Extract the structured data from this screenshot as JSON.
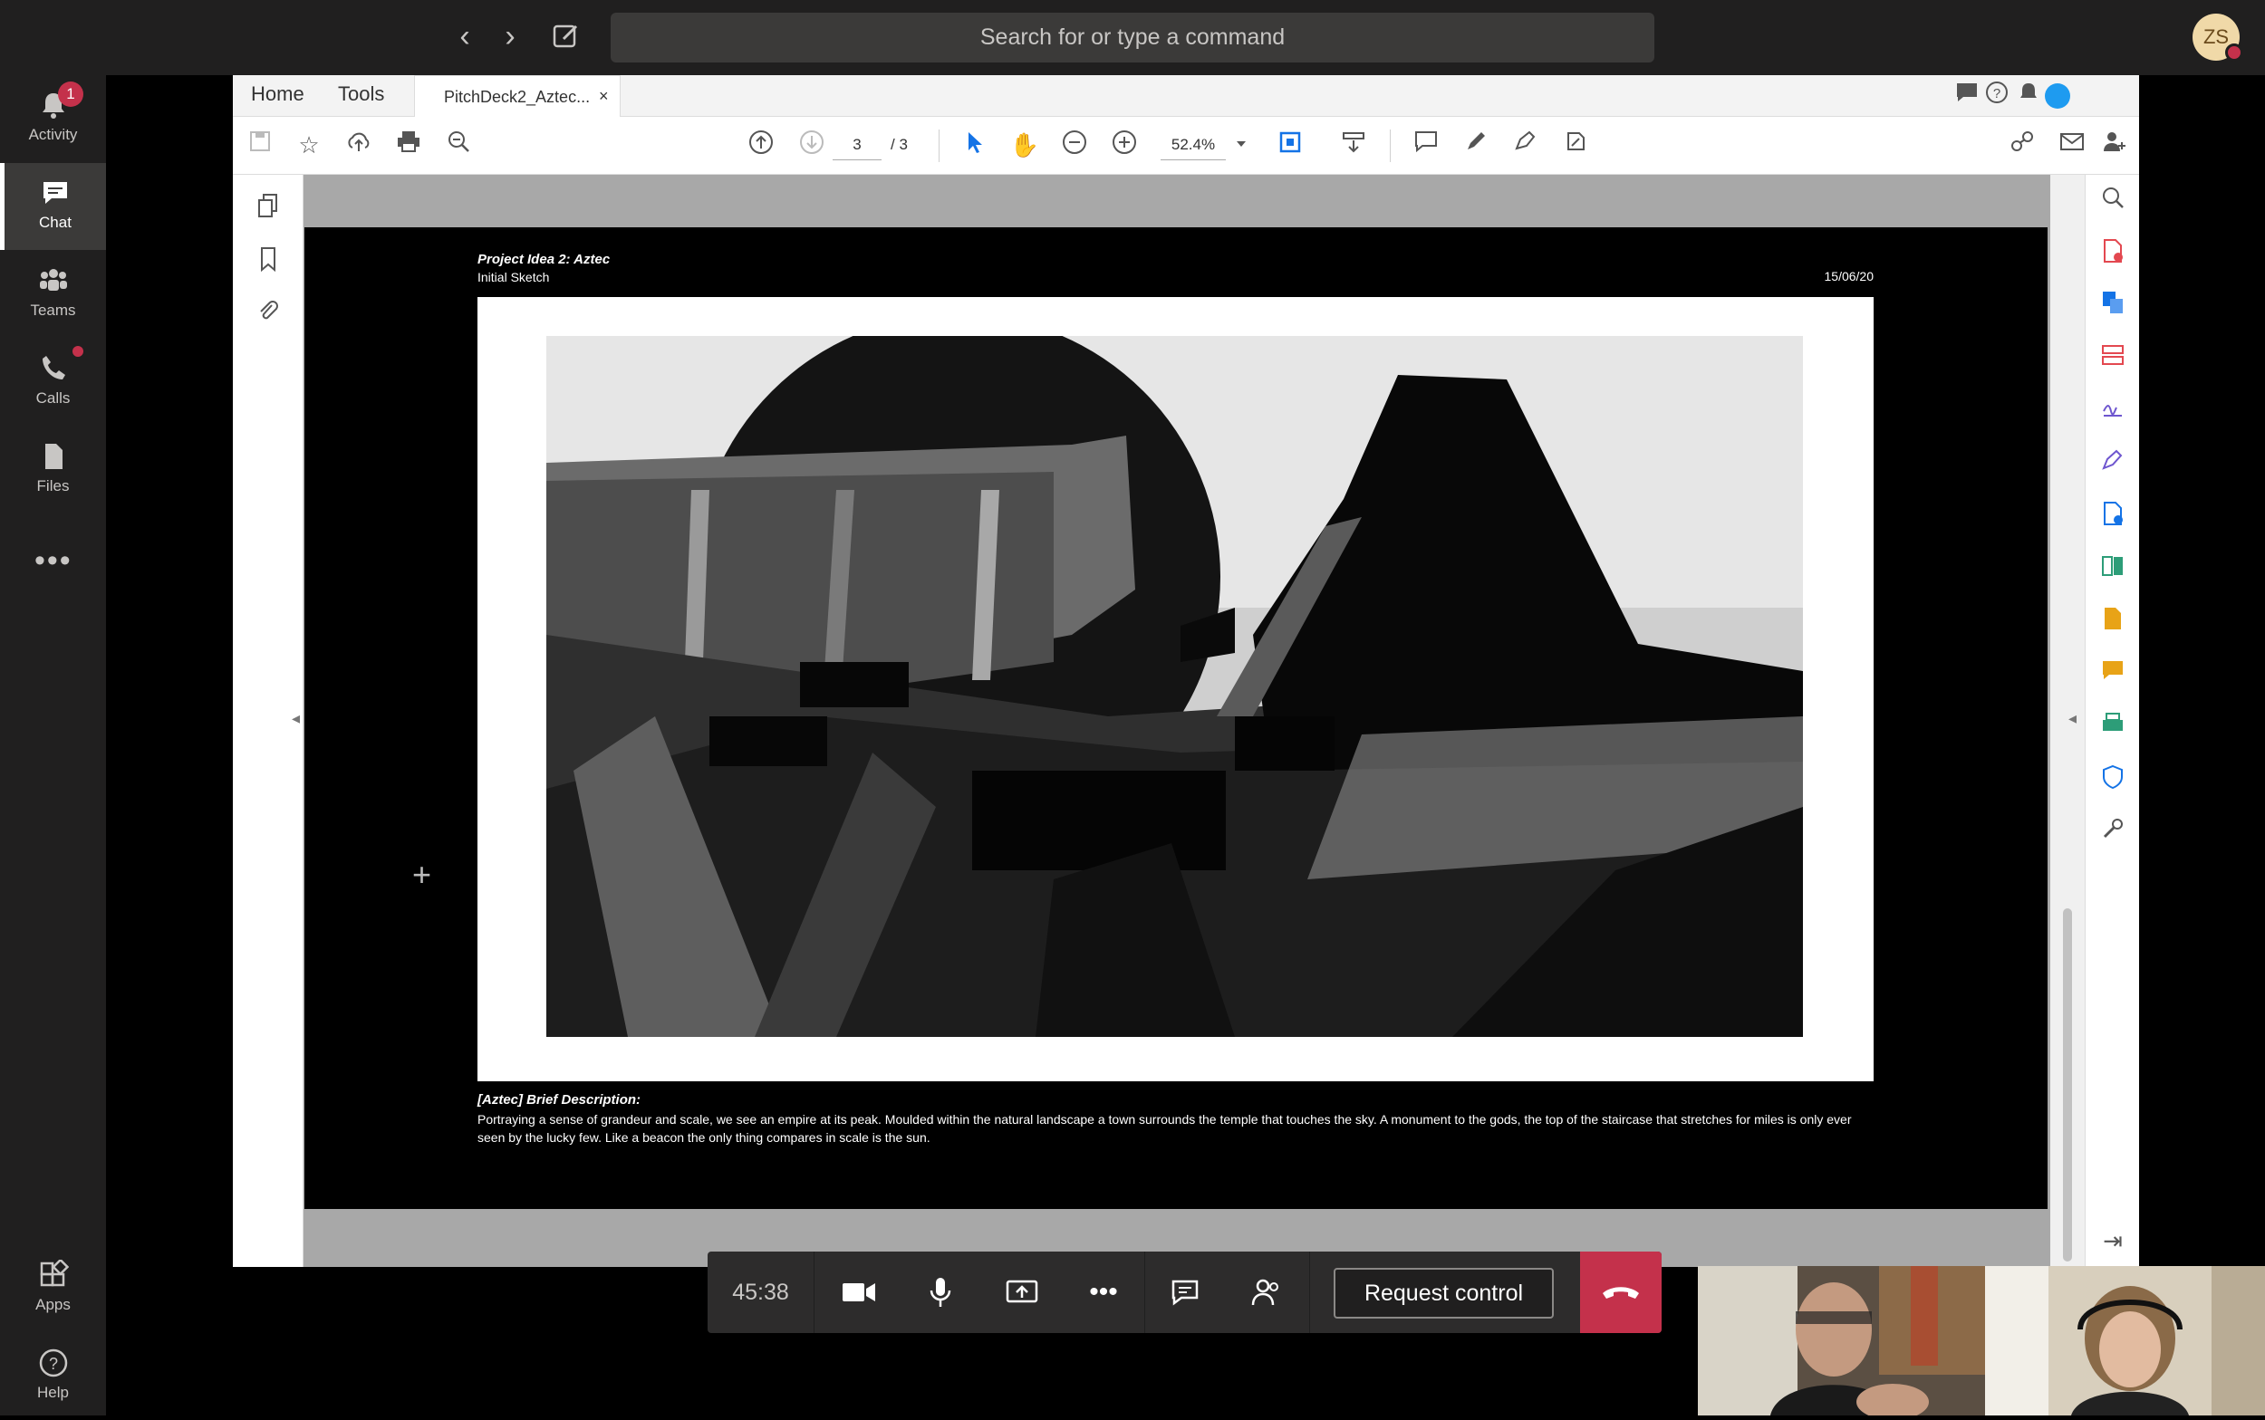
{
  "topbar": {
    "search_placeholder": "Search for or type a command",
    "avatar_initials": "ZS"
  },
  "rail": {
    "items": [
      {
        "label": "Activity",
        "badge": "1"
      },
      {
        "label": "Chat"
      },
      {
        "label": "Teams"
      },
      {
        "label": "Calls"
      },
      {
        "label": "Files"
      },
      {
        "label": "Apps"
      },
      {
        "label": "Help"
      }
    ]
  },
  "acrobat": {
    "menu": {
      "home": "Home",
      "tools": "Tools"
    },
    "tab_title": "PitchDeck2_Aztec...",
    "tab_close": "×",
    "page_current": "3",
    "page_total": "/ 3",
    "zoom": "52.4%"
  },
  "document": {
    "title": "Project Idea 2: Aztec",
    "subtitle": "Initial Sketch",
    "date": "15/06/20",
    "brief_title": "[Aztec] Brief Description:",
    "brief_text": "Portraying a sense of grandeur and scale, we see an empire at its peak. Moulded within the natural landscape a town surrounds the temple that touches the sky. A monument to the gods, the top of the staircase that stretches for miles is only ever seen by the lucky few. Like a beacon the only thing compares in scale is the sun."
  },
  "call": {
    "timer": "45:38",
    "request_control": "Request control"
  },
  "colors": {
    "teams_bg": "#201f1f",
    "rail_active": "#3b3a39",
    "hangup_red": "#c4314b",
    "acrobat_blue": "#1473e6"
  }
}
